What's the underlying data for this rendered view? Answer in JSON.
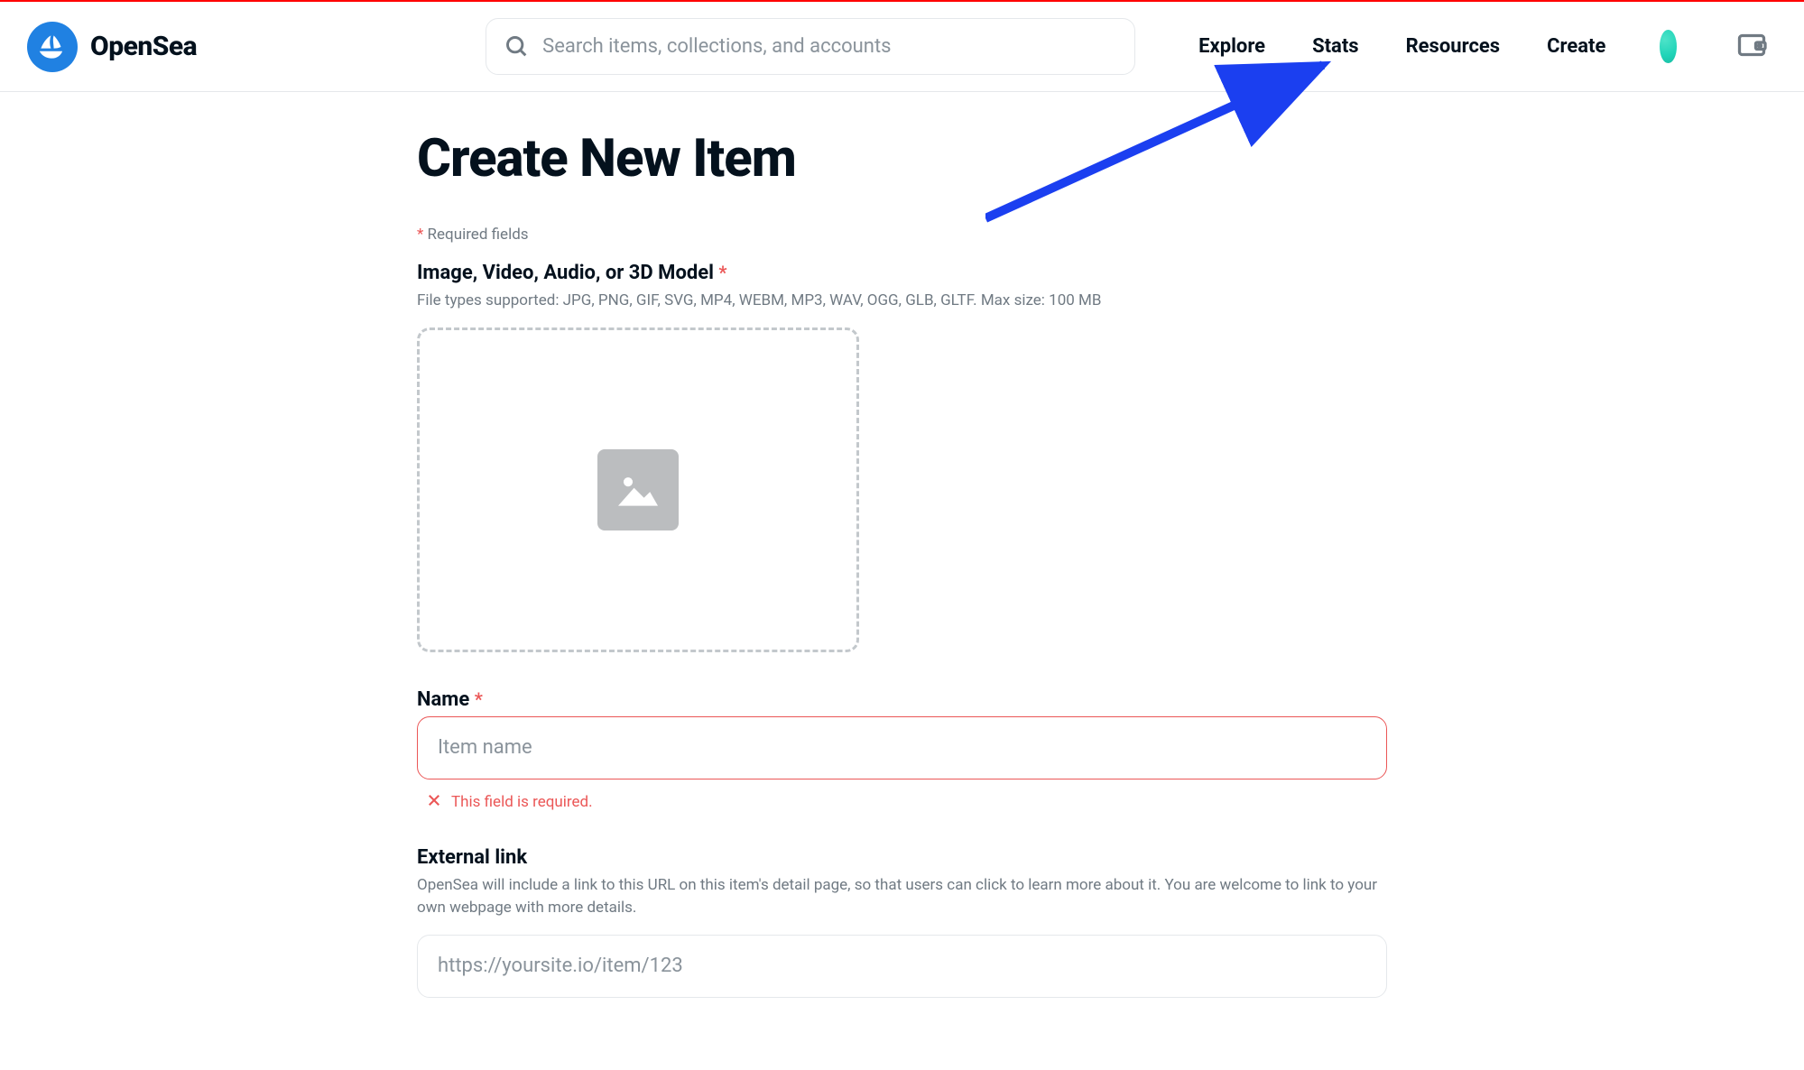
{
  "header": {
    "brand": "OpenSea",
    "search_placeholder": "Search items, collections, and accounts",
    "nav": {
      "explore": "Explore",
      "stats": "Stats",
      "resources": "Resources",
      "create": "Create"
    }
  },
  "page": {
    "title": "Create New Item",
    "required_label": "Required fields"
  },
  "upload": {
    "label": "Image, Video, Audio, or 3D Model",
    "help": "File types supported: JPG, PNG, GIF, SVG, MP4, WEBM, MP3, WAV, OGG, GLB, GLTF. Max size: 100 MB"
  },
  "name": {
    "label": "Name",
    "placeholder": "Item name",
    "error": "This field is required."
  },
  "external": {
    "label": "External link",
    "help": "OpenSea will include a link to this URL on this item's detail page, so that users can click to learn more about it. You are welcome to link to your own webpage with more details.",
    "placeholder": "https://yoursite.io/item/123"
  }
}
